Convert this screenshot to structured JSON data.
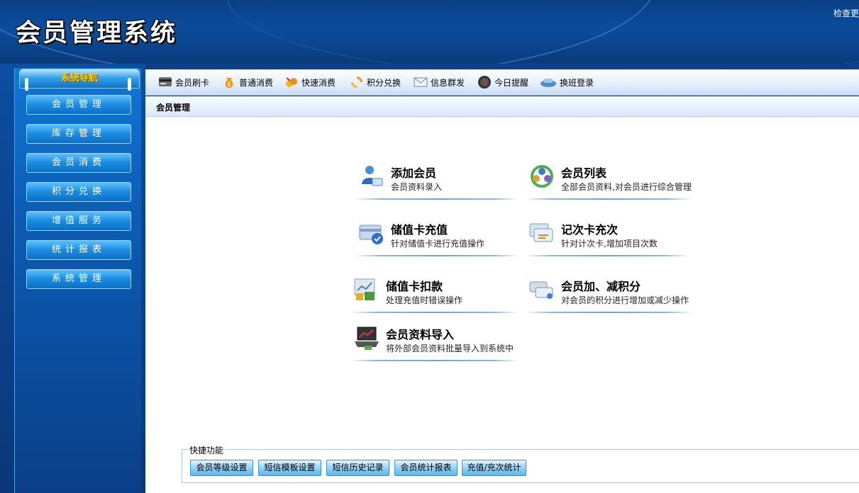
{
  "header": {
    "app_title": "会员管理系统",
    "check_update": "检查更"
  },
  "sidebar": {
    "title": "系统导航",
    "items": [
      {
        "label": "会员管理"
      },
      {
        "label": "库存管理"
      },
      {
        "label": "会员消费"
      },
      {
        "label": "积分兑换"
      },
      {
        "label": "增值服务"
      },
      {
        "label": "统计报表"
      },
      {
        "label": "系统管理"
      }
    ]
  },
  "toolbar": {
    "items": [
      {
        "label": "会员刷卡",
        "icon": "card-reader-icon"
      },
      {
        "label": "普通消费",
        "icon": "money-bag-icon"
      },
      {
        "label": "快速消费",
        "icon": "coins-icon"
      },
      {
        "label": "积分兑换",
        "icon": "exchange-icon"
      },
      {
        "label": "信息群发",
        "icon": "mail-icon"
      },
      {
        "label": "今日提醒",
        "icon": "clock-icon"
      },
      {
        "label": "换班登录",
        "icon": "login-icon"
      }
    ]
  },
  "breadcrumb": {
    "current": "会员管理"
  },
  "functions": [
    {
      "title": "添加会员",
      "desc": "会员资料录入",
      "icon": "add-member-icon"
    },
    {
      "title": "会员列表",
      "desc": "全部会员资料,对会员进行综合管理",
      "icon": "member-list-icon"
    },
    {
      "title": "储值卡充值",
      "desc": "针对储值卡进行充值操作",
      "icon": "card-recharge-icon"
    },
    {
      "title": "记次卡充次",
      "desc": "针对计次卡,增加项目次数",
      "icon": "count-card-icon"
    },
    {
      "title": "储值卡扣款",
      "desc": "处理充值时错误操作",
      "icon": "card-deduct-icon"
    },
    {
      "title": "会员加、减积分",
      "desc": "对会员的积分进行增加或减少操作",
      "icon": "points-adjust-icon"
    },
    {
      "title": "会员资料导入",
      "desc": "将外部会员资料批量导入到系统中",
      "icon": "import-laptop-icon"
    }
  ],
  "quick": {
    "legend": "快捷功能",
    "buttons": [
      {
        "label": "会员等级设置"
      },
      {
        "label": "短信模板设置"
      },
      {
        "label": "短信历史记录"
      },
      {
        "label": "会员统计报表"
      },
      {
        "label": "充值/充次统计"
      }
    ]
  },
  "colors": {
    "header_bg": "#0b4d9c",
    "nav_button": "#1b8be0",
    "nav_title": "#ffd200",
    "quick_button": "#8fd0f6"
  }
}
